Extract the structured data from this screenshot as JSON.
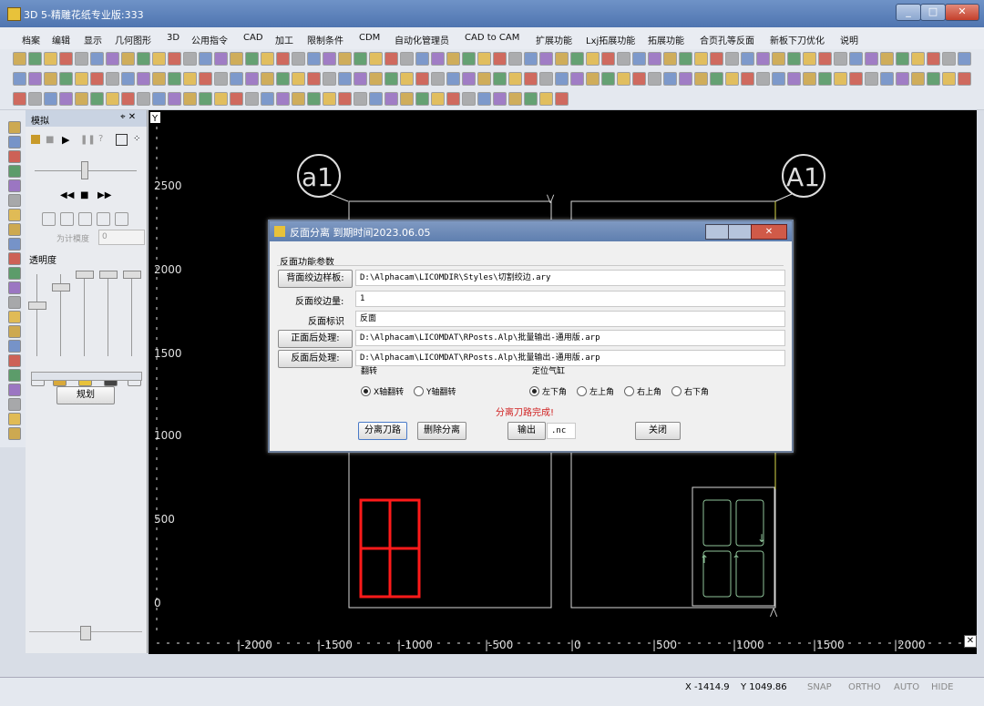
{
  "window": {
    "title": "3D 5-精雕花纸专业版:333",
    "buttons": [
      "_",
      "□",
      "✕"
    ]
  },
  "menu": [
    "档案",
    "编辑",
    "显示",
    "几何图形",
    "3D",
    "公用指令",
    "CAD",
    "加工",
    "限制条件",
    "CDM",
    "自动化管理员",
    "CAD to CAM",
    "扩展功能",
    "Lxj拓展功能",
    "拓展功能",
    "合页孔等反面",
    "新板下刀优化",
    "说明"
  ],
  "panel": {
    "title": "模拟",
    "pin": "⌖ ✕",
    "sim_length_label": "为计模度",
    "sim_length_value": "0",
    "transparency_label": "透明度",
    "plan_button": "规划"
  },
  "canvas": {
    "y_axis_marker": "Y",
    "y_ticks": [
      "2500",
      "2000",
      "1500",
      "1000",
      "500",
      "0"
    ],
    "x_ticks": [
      "|-2000",
      "|-1500",
      "|-1000",
      "|-500",
      "|0",
      "|500",
      "|1000",
      "|1500",
      "|2000"
    ],
    "label_left": "a1",
    "label_right": "A1",
    "colors": {
      "part_outline": "#d7d7d7",
      "red_tool": "#ff1a1a",
      "green_path": "#8fc59a",
      "yellow_line": "#d9d94a"
    }
  },
  "dialog": {
    "title": "反面分离  到期时间2023.06.05",
    "section_title": "反面功能参数",
    "fields": {
      "back_style_button": "背面绞边样板:",
      "back_style_value": "D:\\Alphacam\\LICOMDIR\\Styles\\切割绞边.ary",
      "back_edge_label": "反面绞边量:",
      "back_edge_value": "1",
      "back_mark_label": "反面标识",
      "back_mark_value": "反面",
      "front_post_button": "正面后处理:",
      "front_post_value": "D:\\Alphacam\\LICOMDAT\\RPosts.Alp\\批量输出-通用版.arp",
      "back_post_button": "反面后处理:",
      "back_post_value": "D:\\Alphacam\\LICOMDAT\\RPosts.Alp\\批量输出-通用版.arp"
    },
    "flip_label": "翻转",
    "flip_options": [
      {
        "label": "X轴翻转",
        "selected": true
      },
      {
        "label": "Y轴翻转",
        "selected": false
      }
    ],
    "anchor_label": "定位气缸",
    "anchor_options": [
      {
        "label": "左下角",
        "selected": true
      },
      {
        "label": "左上角",
        "selected": false
      },
      {
        "label": "右上角",
        "selected": false
      },
      {
        "label": "右下角",
        "selected": false
      }
    ],
    "status_message": "分离刀路完成!",
    "status_color": "#d02020",
    "buttons": {
      "separate": "分离刀路",
      "delete": "删除分离",
      "export": "输出",
      "export_ext": ".nc",
      "close": "关闭"
    }
  },
  "status": {
    "x": "X -1414.9",
    "y": "Y 1049.86",
    "snap": "SNAP",
    "ortho": "ORTHO",
    "auto": "AUTO",
    "hide": "HIDE"
  }
}
